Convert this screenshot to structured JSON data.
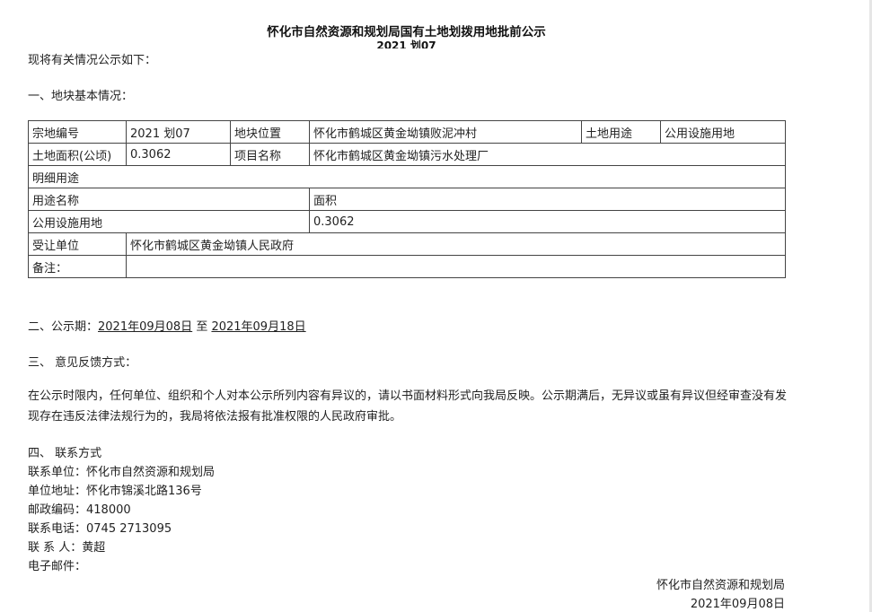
{
  "header": {
    "title": "怀化市自然资源和规划局国有土地划拨用地批前公示",
    "subtitle": "2021    划07"
  },
  "intro": "现将有关情况公示如下：",
  "section1": {
    "heading": "一、地块基本情况："
  },
  "table": {
    "r1": {
      "c1": "宗地编号",
      "c2": "2021    划07",
      "c3": "地块位置",
      "c4": "怀化市鹤城区黄金坳镇败泥冲村",
      "c5": "土地用途",
      "c6": "公用设施用地"
    },
    "r2": {
      "c1": "土地面积(公顷)",
      "c2": "0.3062",
      "c3": "项目名称",
      "c4": "怀化市鹤城区黄金坳镇污水处理厂"
    },
    "r3": {
      "c1": "明细用途"
    },
    "r4": {
      "c1": "用途名称",
      "c2": "面积"
    },
    "r5": {
      "c1": "公用设施用地",
      "c2": "0.3062"
    },
    "r6": {
      "c1": "受让单位",
      "c2": "怀化市鹤城区黄金坳镇人民政府"
    },
    "r7": {
      "c1": "备注：",
      "c2": ""
    }
  },
  "section2": {
    "label": "二、公示期：",
    "start": "2021年09月08日",
    "to": " 至 ",
    "end": "2021年09月18日"
  },
  "section3": {
    "heading": "三、 意见反馈方式：",
    "body": "在公示时限内，任何单位、组织和个人对本公示所列内容有异议的，请以书面材料形式向我局反映。公示期满后，无异议或虽有异议但经审查没有发现存在违反法律法规行为的，我局将依法报有批准权限的人民政府审批。"
  },
  "section4": {
    "heading": "四、 联系方式",
    "unit": "联系单位：怀化市自然资源和规划局",
    "address": "单位地址：怀化市锦溪北路136号",
    "postcode": "邮政编码：418000",
    "phone": "联系电话：0745    2713095",
    "person": "联 系 人：黄超",
    "email": "电子邮件："
  },
  "footer": {
    "org": "怀化市自然资源和规划局",
    "date": "2021年09月08日"
  }
}
